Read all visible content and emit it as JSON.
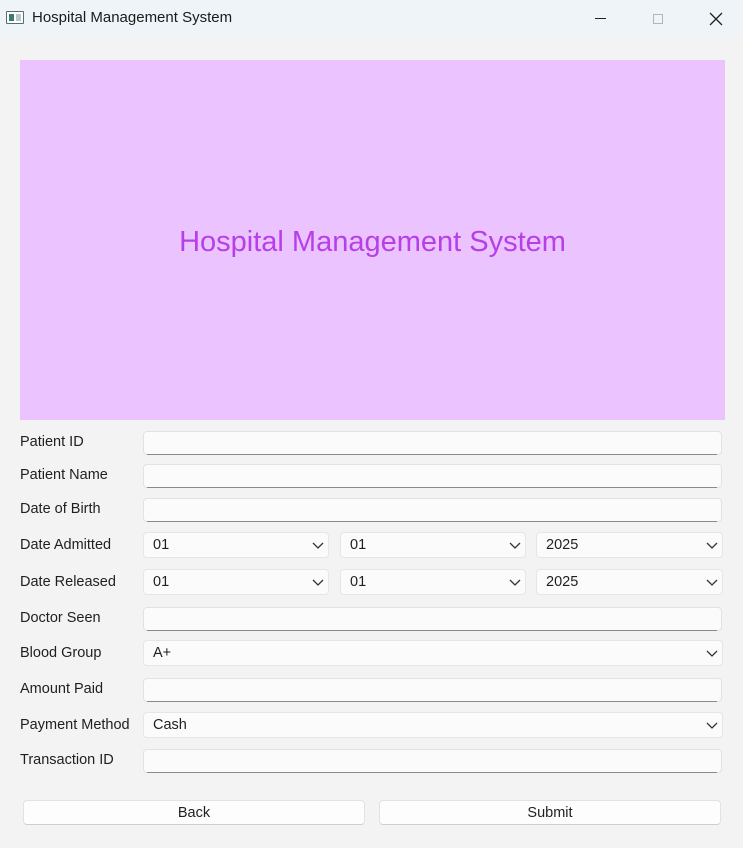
{
  "window": {
    "title": "Hospital Management System",
    "controls": [
      "minimize-icon",
      "maximize-icon",
      "close-icon"
    ]
  },
  "banner": {
    "title": "Hospital Management System",
    "background": "#eac3ff",
    "text_color": "#b73ee8"
  },
  "form": {
    "patient_id": {
      "label": "Patient ID",
      "value": ""
    },
    "patient_name": {
      "label": "Patient Name",
      "value": ""
    },
    "dob": {
      "label": "Date of Birth",
      "value": ""
    },
    "date_admitted": {
      "label": "Date Admitted",
      "day": "01",
      "month": "01",
      "year": "2025"
    },
    "date_released": {
      "label": "Date Released",
      "day": "01",
      "month": "01",
      "year": "2025"
    },
    "doctor_seen": {
      "label": "Doctor Seen",
      "value": ""
    },
    "blood_group": {
      "label": "Blood Group",
      "value": "A+"
    },
    "amount_paid": {
      "label": "Amount Paid",
      "value": ""
    },
    "payment_method": {
      "label": "Payment Method",
      "value": "Cash"
    },
    "transaction_id": {
      "label": "Transaction ID",
      "value": ""
    }
  },
  "buttons": {
    "back": "Back",
    "submit": "Submit"
  }
}
